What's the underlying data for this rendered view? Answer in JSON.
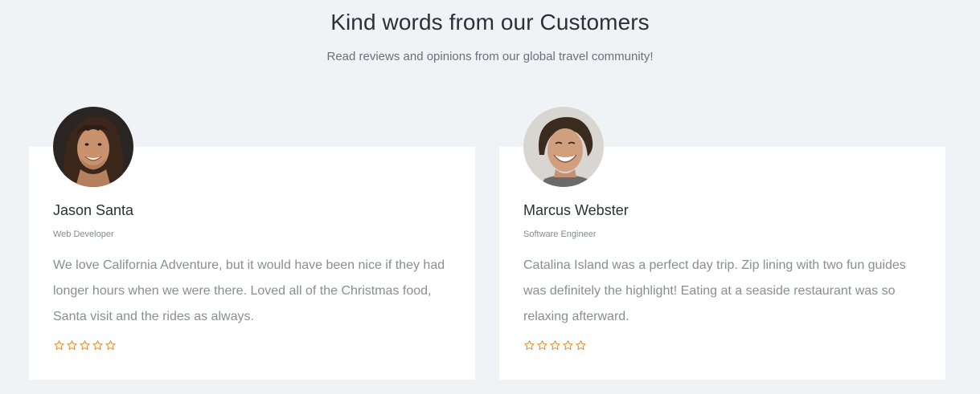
{
  "section": {
    "title": "Kind words from our Customers",
    "subtitle": "Read reviews and opinions from our global travel community!"
  },
  "reviews": [
    {
      "name": "Jason Santa",
      "role": "Web Developer",
      "quote": "We love California Adventure, but it would have been nice if they had longer hours when we were there. Loved all of the Christmas food, Santa visit and the rides as always.",
      "rating": 0,
      "max_rating": 5
    },
    {
      "name": "Marcus Webster",
      "role": "Software Engineer",
      "quote": "Catalina Island was a perfect day trip. Zip lining with two fun guides was definitely the highlight! Eating at a seaside restaurant was so relaxing afterward.",
      "rating": 0,
      "max_rating": 5
    }
  ],
  "colors": {
    "background": "#f0f3f6",
    "card": "#ffffff",
    "star_outline": "#e08a2c",
    "heading": "#2c2f33",
    "body_text": "#8a8d91"
  },
  "icons": {
    "star": "star-outline-icon"
  }
}
